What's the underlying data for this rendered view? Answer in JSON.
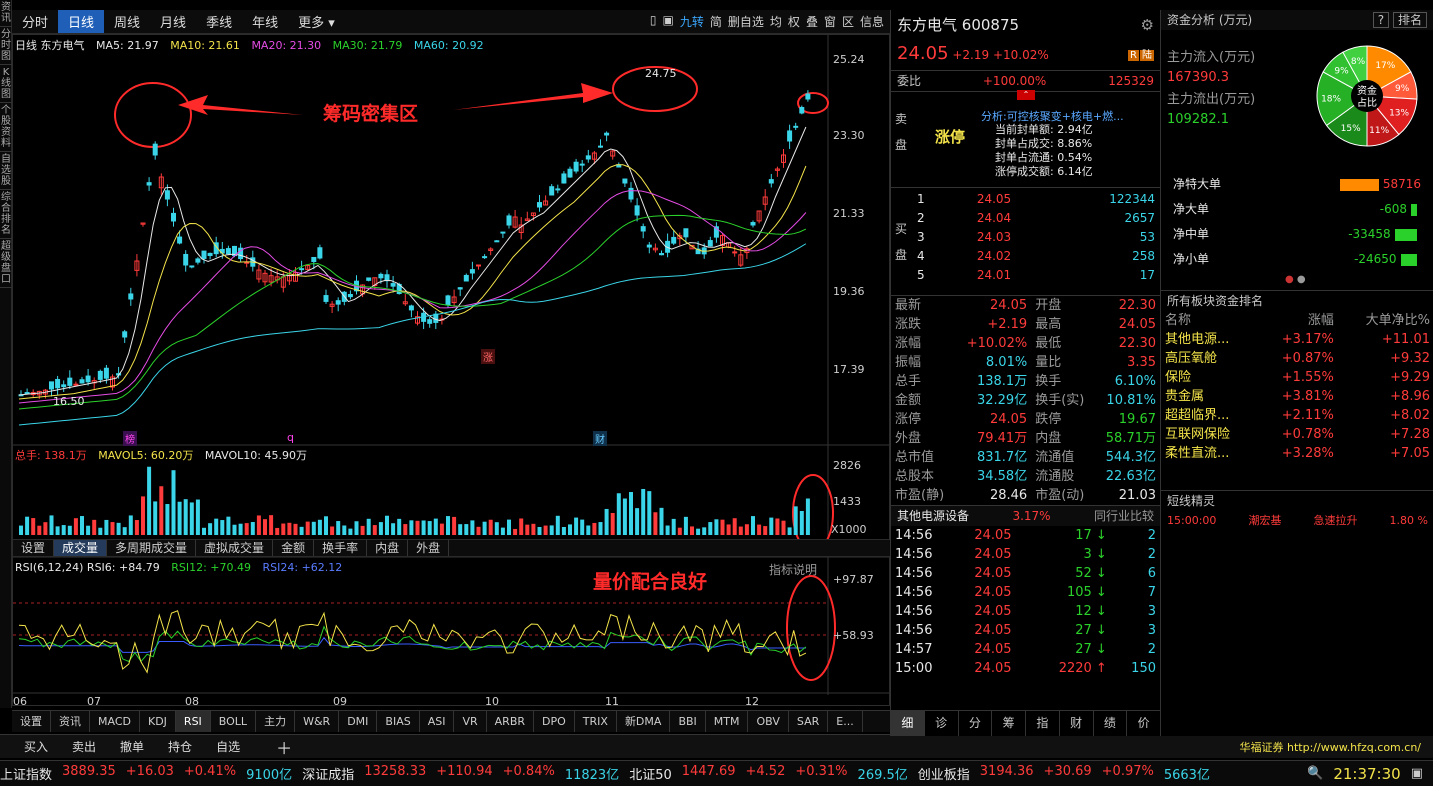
{
  "left_tabs": [
    "资讯",
    "分时图",
    "K线图",
    "个股资料",
    "自选股",
    "综合排名",
    "超级盘口"
  ],
  "periods": [
    "分时",
    "日线",
    "周线",
    "月线",
    "季线",
    "年线",
    "更多"
  ],
  "active_period": "日线",
  "toolbar": [
    "九转",
    "简",
    "删自选",
    "均",
    "权",
    "叠",
    "窗",
    "区",
    "信息"
  ],
  "chart_title": "日线  东方电气",
  "ma": {
    "ma5": "MA5: 21.97",
    "ma10": "MA10: 21.61",
    "ma20": "MA20: 21.30",
    "ma30": "MA30: 21.79",
    "ma60": "MA60: 20.92"
  },
  "price_axis": [
    "25.24",
    "23.30",
    "21.33",
    "19.36",
    "17.39"
  ],
  "annotations": {
    "chips": "筹码密集区",
    "volume": "量价配合良好",
    "high": "24.75",
    "low": "16.50"
  },
  "markers": {
    "bang": "榜",
    "q": "q",
    "zhang": "涨",
    "cai": "财"
  },
  "volume_line": {
    "total": "总手: 138.1万",
    "mavol5": "MAVOL5: 60.20万",
    "mavol10": "MAVOL10: 45.90万"
  },
  "volume_axis": [
    "2826",
    "1433",
    "X1000"
  ],
  "sub_tabs": [
    "设置",
    "成交量",
    "多周期成交量",
    "虚拟成交量",
    "金额",
    "换手率",
    "内盘",
    "外盘"
  ],
  "rsi_line": {
    "label": "RSI(6,12,24) RSI6: +84.79",
    "rsi12": "RSI12: +70.49",
    "rsi24": "RSI24: +62.12"
  },
  "rsi_axis": [
    "+97.87",
    "+58.93"
  ],
  "indicator_help": "指标说明",
  "months": [
    "06",
    "07",
    "08",
    "09",
    "10",
    "11",
    "12"
  ],
  "indicator_tabs": [
    "设置",
    "资讯",
    "MACD",
    "KDJ",
    "RSI",
    "BOLL",
    "主力",
    "W&R",
    "DMI",
    "BIAS",
    "ASI",
    "VR",
    "ARBR",
    "DPO",
    "TRIX",
    "新DMA",
    "BBI",
    "MTM",
    "OBV",
    "SAR",
    "E..."
  ],
  "active_indicator": "RSI",
  "trade_buttons": [
    "买入",
    "卖出",
    "撤单",
    "持仓",
    "自选"
  ],
  "broker": "华福证券 http://www.hfzq.com.cn/",
  "stock": {
    "name": "东方电气",
    "code": "600875",
    "price": "24.05",
    "change": "+2.19",
    "pct": "+10.02%",
    "weibi_label": "委比",
    "weibi": "+100.00%",
    "weicha": "125329"
  },
  "limit_up": {
    "label": "涨停",
    "sell_label": "卖盘",
    "analysis": "分析:可控核聚变+核电+燃...",
    "lines": [
      "当前封单额: 2.94亿",
      "封单占成交: 8.86%",
      "封单占流通: 0.54%",
      "涨停成交额: 6.14亿"
    ]
  },
  "bids": [
    [
      "1",
      "24.05",
      "122344"
    ],
    [
      "2",
      "24.04",
      "2657"
    ],
    [
      "3",
      "24.03",
      "53"
    ],
    [
      "4",
      "24.02",
      "258"
    ],
    [
      "5",
      "24.01",
      "17"
    ]
  ],
  "stats": [
    [
      "最新",
      "24.05",
      "开盘",
      "22.30"
    ],
    [
      "涨跌",
      "+2.19",
      "最高",
      "24.05"
    ],
    [
      "涨幅",
      "+10.02%",
      "最低",
      "22.30"
    ],
    [
      "振幅",
      "8.01%",
      "量比",
      "3.35"
    ],
    [
      "总手",
      "138.1万",
      "换手",
      "6.10%"
    ],
    [
      "金额",
      "32.29亿",
      "换手(实)",
      "10.81%"
    ],
    [
      "涨停",
      "24.05",
      "跌停",
      "19.67"
    ],
    [
      "外盘",
      "79.41万",
      "内盘",
      "58.71万"
    ],
    [
      "总市值",
      "831.7亿",
      "流通值",
      "544.3亿"
    ],
    [
      "总股本",
      "34.58亿",
      "流通股",
      "22.63亿"
    ],
    [
      "市盈(静)",
      "28.46",
      "市盈(动)",
      "21.03"
    ]
  ],
  "sector": {
    "name": "其他电源设备",
    "pct": "3.17%",
    "compare": "同行业比较"
  },
  "ticks": [
    [
      "14:56",
      "24.05",
      "17",
      "2"
    ],
    [
      "14:56",
      "24.05",
      "3",
      "2"
    ],
    [
      "14:56",
      "24.05",
      "52",
      "6"
    ],
    [
      "14:56",
      "24.05",
      "105",
      "7"
    ],
    [
      "14:56",
      "24.05",
      "12",
      "3"
    ],
    [
      "14:56",
      "24.05",
      "27",
      "3"
    ],
    [
      "14:57",
      "24.05",
      "27",
      "2"
    ],
    [
      "15:00",
      "24.05",
      "2220",
      "150"
    ]
  ],
  "mid_tabs": [
    "细",
    "诊",
    "分",
    "筹",
    "指",
    "财",
    "绩",
    "价"
  ],
  "fund": {
    "title": "资金分析 (万元)",
    "q": "?",
    "rank": "排名",
    "inflow_label": "主力流入(万元)",
    "inflow": "167390.3",
    "outflow_label": "主力流出(万元)",
    "outflow": "109282.1",
    "pie_center": "资金占比",
    "pie": [
      "17%",
      "9%",
      "13%",
      "11%",
      "15%",
      "18%",
      "9%",
      "8%"
    ]
  },
  "net": [
    [
      "净特大单",
      "58716"
    ],
    [
      "净大单",
      "-608"
    ],
    [
      "净中单",
      "-33458"
    ],
    [
      "净小单",
      "-24650"
    ]
  ],
  "sector_rank": {
    "title": "所有板块资金排名",
    "headers": [
      "名称",
      "涨幅",
      "大单净比%"
    ],
    "rows": [
      [
        "其他电源...",
        "+3.17%",
        "+11.01"
      ],
      [
        "高压氧舱",
        "+0.87%",
        "+9.32"
      ],
      [
        "保险",
        "+1.55%",
        "+9.29"
      ],
      [
        "贵金属",
        "+3.81%",
        "+8.96"
      ],
      [
        "超超临界...",
        "+2.11%",
        "+8.02"
      ],
      [
        "互联网保险",
        "+0.78%",
        "+7.28"
      ],
      [
        "柔性直流...",
        "+3.28%",
        "+7.05"
      ]
    ]
  },
  "short_elf": {
    "title": "短线精灵",
    "time": "15:00:00",
    "name": "潮宏基",
    "event": "急速拉升",
    "value": "1.80 %"
  },
  "indices": [
    [
      "上证指数",
      "3889.35",
      "+16.03",
      "+0.41%",
      "9100亿"
    ],
    [
      "深证成指",
      "13258.33",
      "+110.94",
      "+0.84%",
      "11823亿"
    ],
    [
      "北证50",
      "1447.69",
      "+4.52",
      "+0.31%",
      "269.5亿"
    ],
    [
      "创业板指",
      "3194.36",
      "+30.69",
      "+0.97%",
      "5663亿"
    ]
  ],
  "clock": "21:37:30",
  "colors": {
    "up": "#ff3b3b",
    "down": "#2bd12b",
    "accent": "#1f5fb8"
  }
}
